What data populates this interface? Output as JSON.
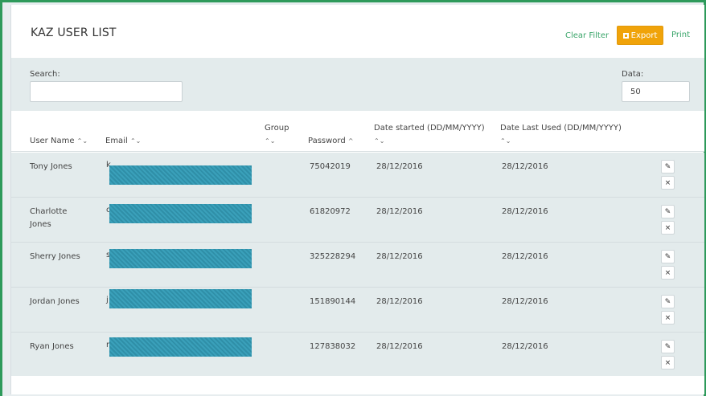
{
  "header": {
    "title": "KAZ USER LIST",
    "clear_filter": "Clear Filter",
    "export_label": "Export",
    "print_label": "Print"
  },
  "filters": {
    "search_label": "Search:",
    "search_value": "",
    "data_label": "Data:",
    "data_value": "50"
  },
  "table": {
    "columns": {
      "user_name": "User Name",
      "email": "Email",
      "group": "Group",
      "password": "Password",
      "date_started": "Date started (DD/MM/YYYY)",
      "date_last_used": "Date Last Used (DD/MM/YYYY)"
    },
    "sort_both": "⌃⌄",
    "sort_asc": "^",
    "rows": [
      {
        "user_line1": "Tony Jones",
        "user_line2": "",
        "email_peek": "k",
        "password": "75042019",
        "date_started": "28/12/2016",
        "date_last_used": "28/12/2016"
      },
      {
        "user_line1": "Charlotte",
        "user_line2": "Jones",
        "email_peek": "c",
        "password": "61820972",
        "date_started": "28/12/2016",
        "date_last_used": "28/12/2016"
      },
      {
        "user_line1": "Sherry Jones",
        "user_line2": "",
        "email_peek": "s",
        "password": "325228294",
        "date_started": "28/12/2016",
        "date_last_used": "28/12/2016"
      },
      {
        "user_line1": "Jordan Jones",
        "user_line2": "",
        "email_peek": "j",
        "password": "151890144",
        "date_started": "28/12/2016",
        "date_last_used": "28/12/2016"
      },
      {
        "user_line1": "Ryan Jones",
        "user_line2": "",
        "email_peek": "r",
        "password": "127838032",
        "date_started": "28/12/2016",
        "date_last_used": "28/12/2016"
      }
    ],
    "edit_glyph": "✎",
    "delete_glyph": "×"
  },
  "colors": {
    "accent_green": "#3aa56a",
    "export_orange": "#f0a30a",
    "redaction_blue": "#2f8fa8"
  }
}
